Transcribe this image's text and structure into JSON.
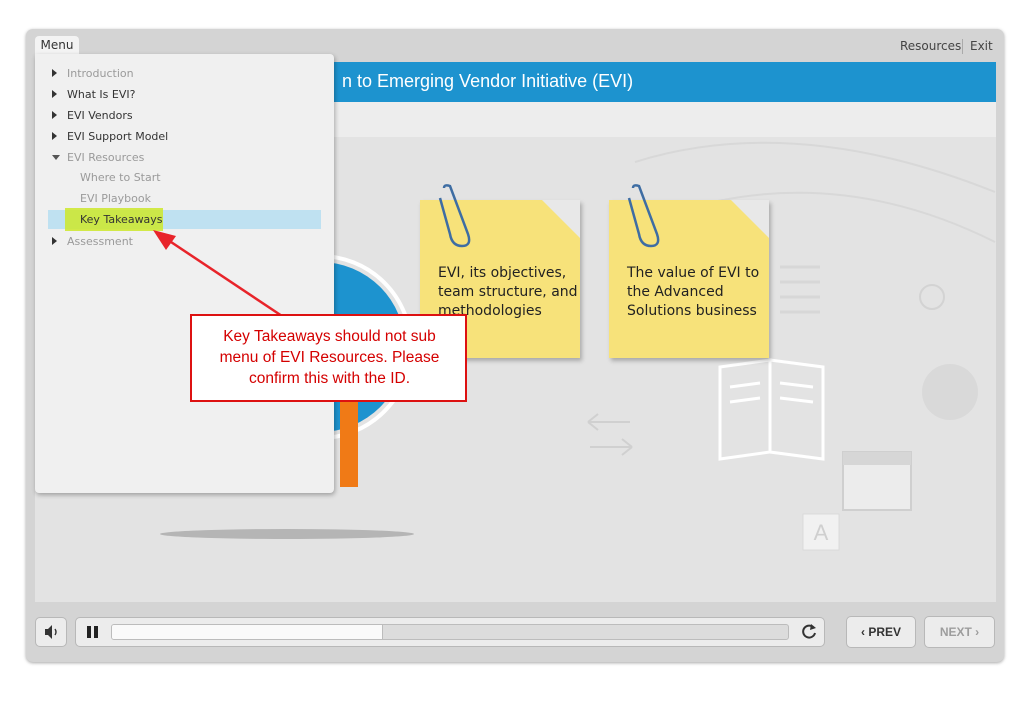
{
  "topbar": {
    "menu_tab_label": "Menu",
    "resources_label": "Resources",
    "exit_label": "Exit"
  },
  "slide": {
    "title": "n to Emerging Vendor Initiative (EVI)",
    "notes": [
      {
        "lines": [
          "EVI, its objectives,",
          "team structure, and",
          "methodologies"
        ]
      },
      {
        "lines": [
          "The value of EVI to",
          "the Advanced",
          "Solutions business"
        ]
      }
    ]
  },
  "menu": {
    "items": [
      {
        "label": "Introduction",
        "state": "collapsed",
        "dim": true
      },
      {
        "label": "What Is EVI?",
        "state": "collapsed",
        "dim": false
      },
      {
        "label": "EVI Vendors",
        "state": "collapsed",
        "dim": false
      },
      {
        "label": "EVI Support Model",
        "state": "collapsed",
        "dim": false
      },
      {
        "label": "EVI Resources",
        "state": "expanded",
        "dim": true
      },
      {
        "label": "Where to Start",
        "sub": true,
        "dim": true
      },
      {
        "label": "EVI Playbook",
        "sub": true,
        "dim": true
      },
      {
        "label": "Key Takeaways",
        "sub": true,
        "selected": true
      },
      {
        "label": "Assessment",
        "state": "collapsed",
        "dim": true
      }
    ]
  },
  "annotation": {
    "text_lines": [
      "Key Takeaways should not sub",
      "menu of EVI Resources. Please",
      "confirm this with the ID."
    ]
  },
  "controls": {
    "volume_icon": "speaker-icon",
    "pause_icon": "pause-icon",
    "replay_icon": "replay-icon",
    "progress_fraction": 0.4,
    "prev_label": "PREV",
    "next_label": "NEXT"
  },
  "colors": {
    "title_bar": "#1d93cf",
    "note": "#f7e27a",
    "callout_border": "#dd1111",
    "callout_text": "#d40000",
    "selection": "#bfe1f1",
    "highlight": "#cde82a"
  }
}
